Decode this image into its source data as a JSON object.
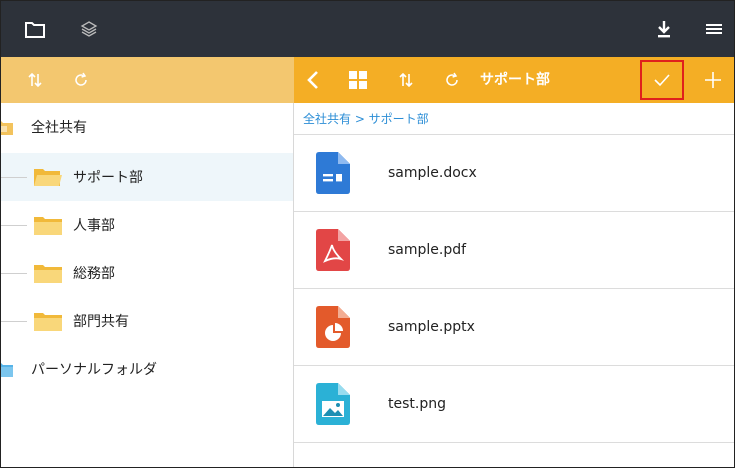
{
  "topbar": {
    "icons": [
      "folder-icon",
      "layers-icon",
      "download-icon",
      "menu-icon"
    ]
  },
  "left_header": {
    "icons": [
      "sort-icon",
      "refresh-icon"
    ]
  },
  "right_header": {
    "icons": [
      "back-icon",
      "grid-view-icon",
      "sort-icon",
      "refresh-icon",
      "check-icon",
      "add-icon"
    ],
    "title": "サポート部"
  },
  "tree": {
    "items": [
      {
        "label": "全社共有",
        "level": 0,
        "selected": false,
        "folder_color": "#f3c35d"
      },
      {
        "label": "サポート部",
        "level": 1,
        "selected": true,
        "folder_color": "#f6c556"
      },
      {
        "label": "人事部",
        "level": 1,
        "selected": false,
        "folder_color": "#f6c556"
      },
      {
        "label": "総務部",
        "level": 1,
        "selected": false,
        "folder_color": "#f6c556"
      },
      {
        "label": "部門共有",
        "level": 1,
        "selected": false,
        "folder_color": "#f6c556"
      },
      {
        "label": "パーソナルフォルダ",
        "level": 0,
        "selected": false,
        "folder_color": "#56b3e8"
      }
    ]
  },
  "breadcrumb": "全社共有 > サポート部",
  "files": [
    {
      "name": "sample.docx",
      "type": "docx",
      "color": "#2e7ad6"
    },
    {
      "name": "sample.pdf",
      "type": "pdf",
      "color": "#e24646"
    },
    {
      "name": "sample.pptx",
      "type": "pptx",
      "color": "#e35a2b"
    },
    {
      "name": "test.png",
      "type": "png",
      "color": "#2bb1d6"
    }
  ],
  "colors": {
    "topbar": "#2d323a",
    "left_header": "#f3c76f",
    "right_header": "#f4ae25",
    "highlight_border": "#e0201c",
    "link": "#2c8ed6"
  }
}
